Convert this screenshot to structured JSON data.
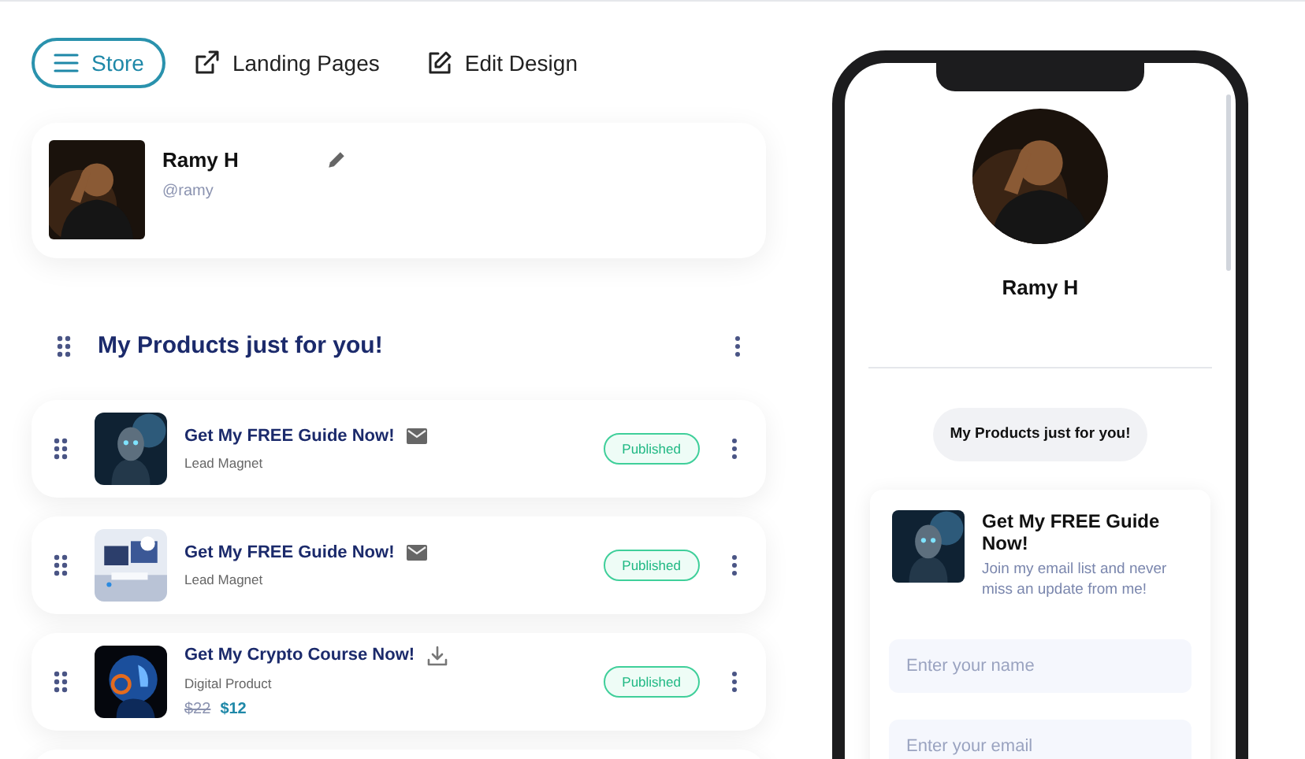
{
  "nav": [
    {
      "label": "Store",
      "kind": "menu",
      "selected": true
    },
    {
      "label": "Landing Pages",
      "kind": "external",
      "selected": false
    },
    {
      "label": "Edit Design",
      "kind": "edit",
      "selected": false
    }
  ],
  "profile": {
    "name": "Ramy H",
    "handle": "@ramy"
  },
  "section": {
    "title": "My Products just for you!"
  },
  "products": [
    {
      "title": "Get My FREE Guide Now!",
      "type": "Lead Magnet",
      "kind": "email",
      "status": "Published"
    },
    {
      "title": "Get My FREE Guide Now!",
      "type": "Lead Magnet",
      "kind": "email",
      "status": "Published"
    },
    {
      "title": "Get My Crypto Course Now!",
      "type": "Digital Product",
      "kind": "download",
      "status": "Published",
      "old_price": "$22",
      "price": "$12"
    }
  ],
  "preview": {
    "name": "Ramy H",
    "pill": "My Products just for you!",
    "card": {
      "title": "Get My FREE Guide Now!",
      "description": "Join my email list and never miss an update from me!",
      "fields": [
        {
          "placeholder": "Enter your name"
        },
        {
          "placeholder": "Enter your email"
        }
      ]
    }
  }
}
